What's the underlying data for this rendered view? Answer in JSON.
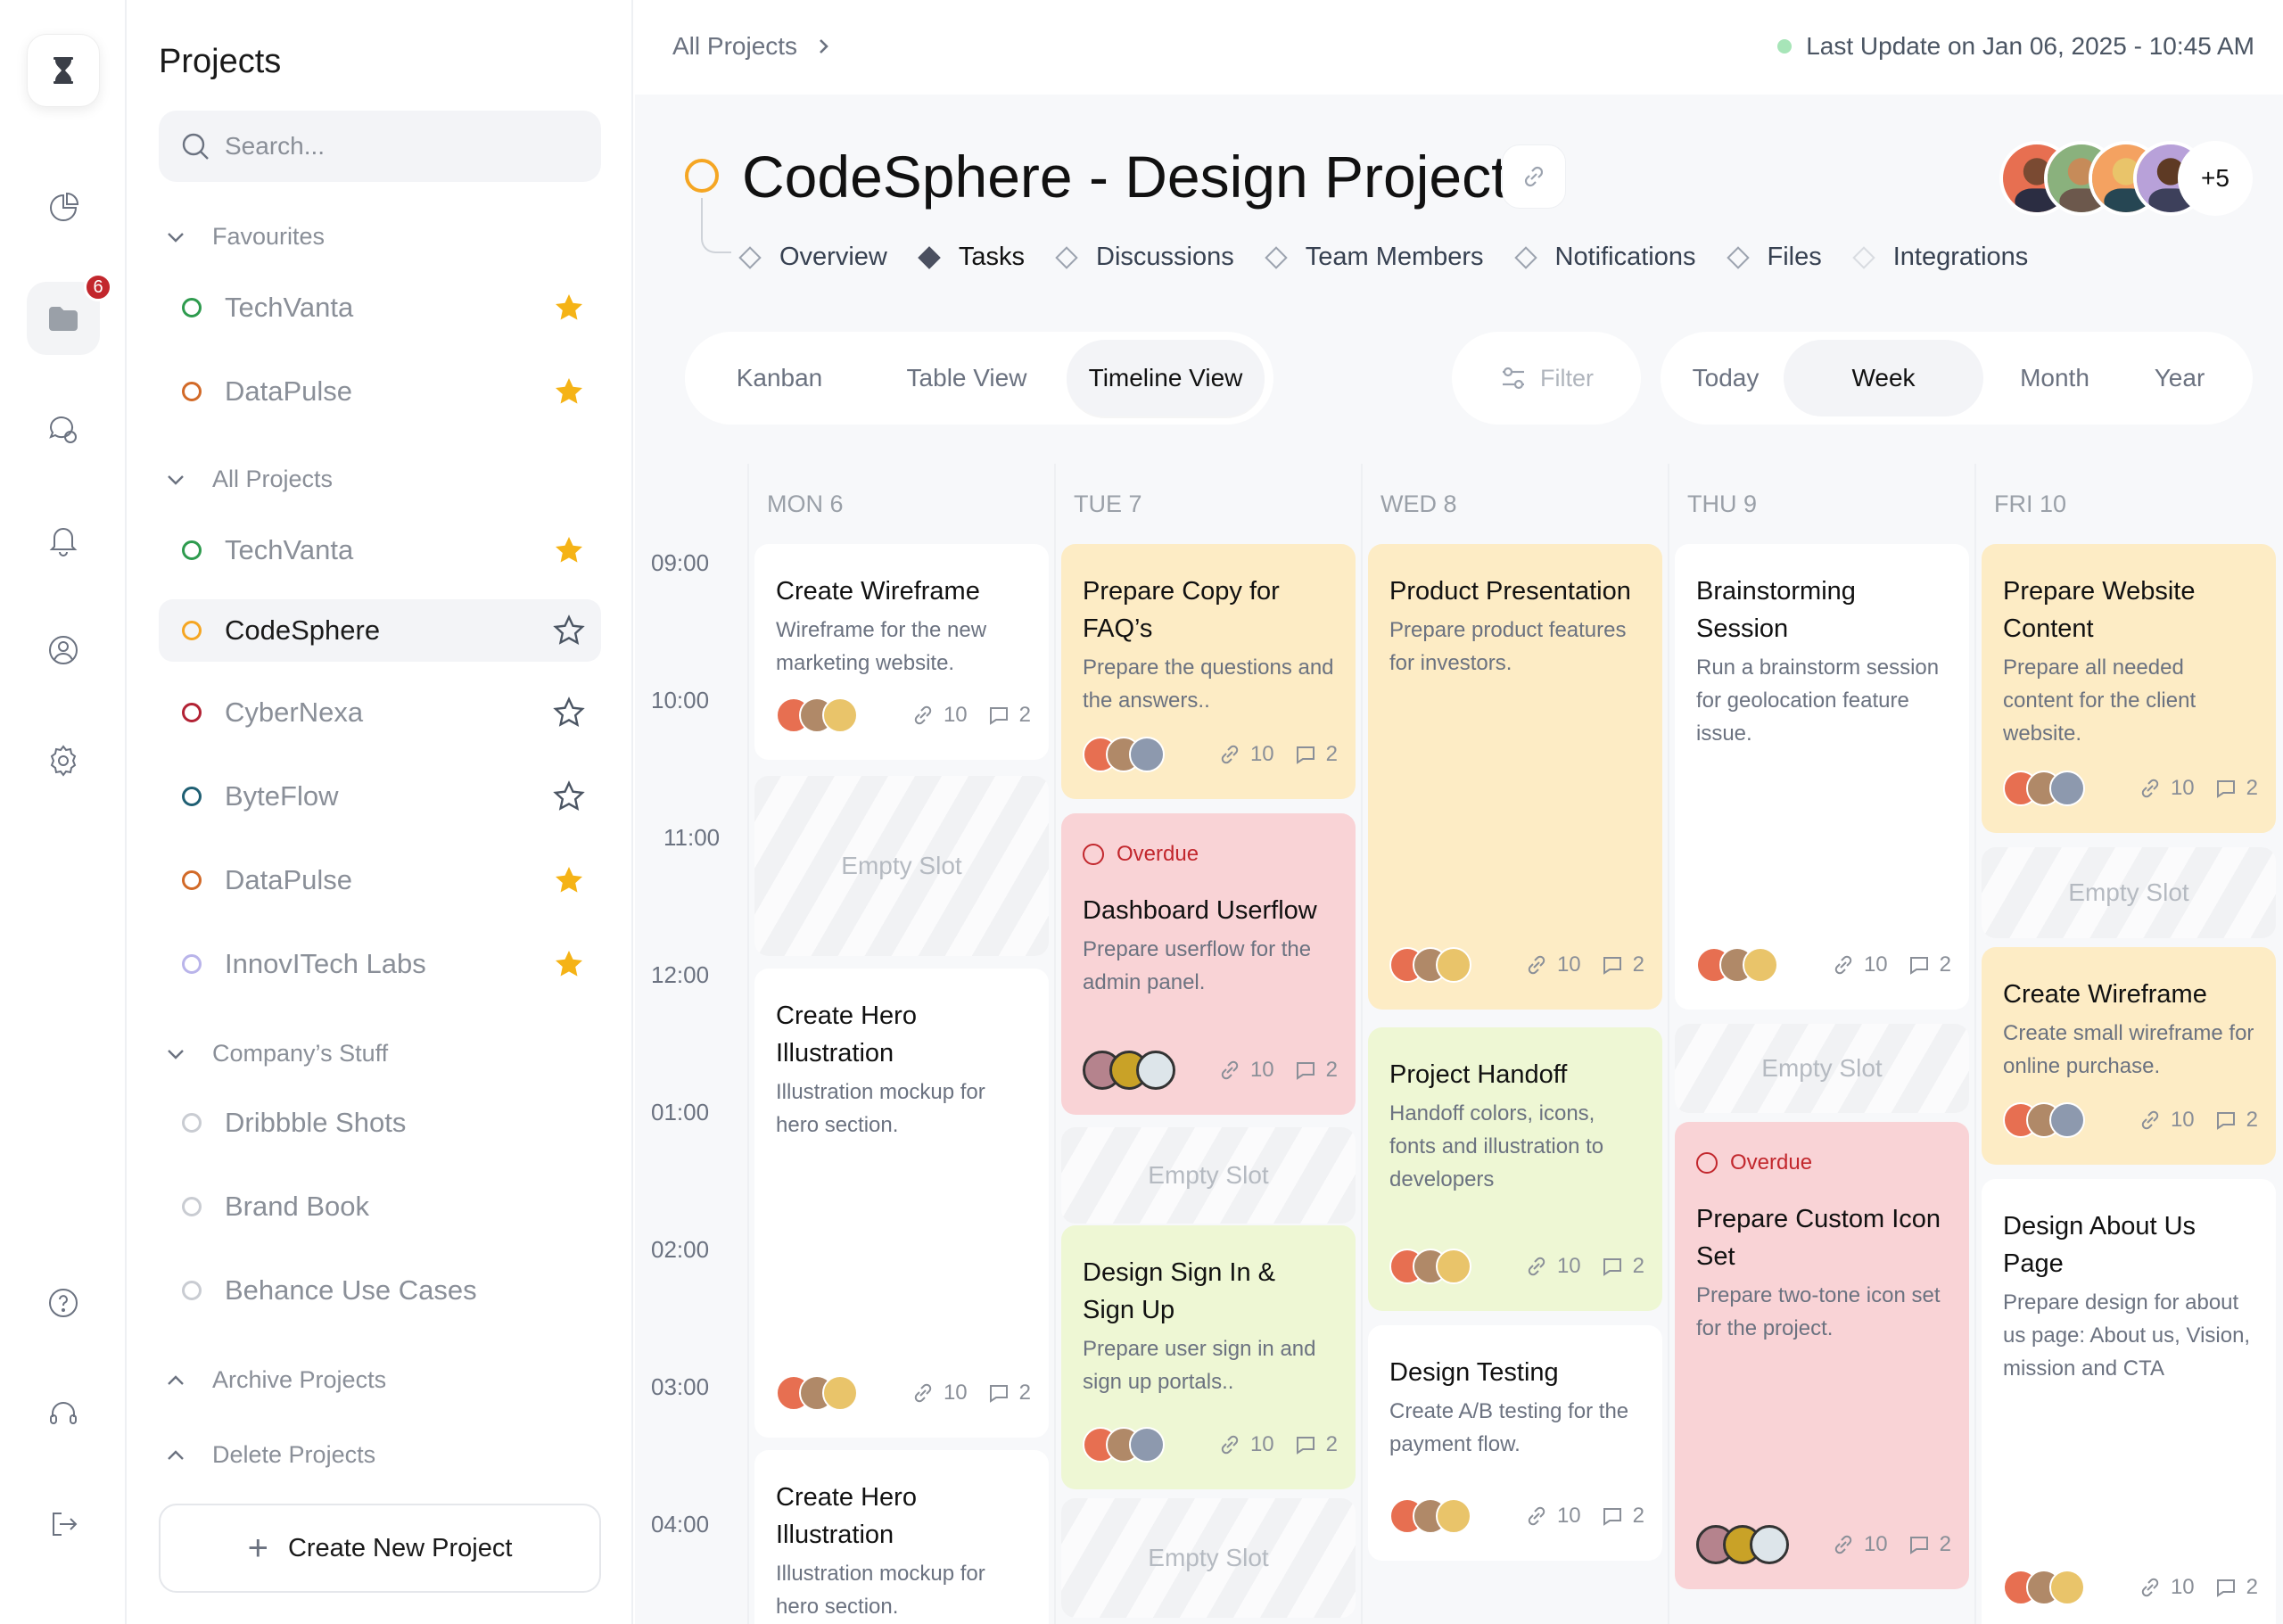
{
  "sidebar": {
    "title": "Projects",
    "search_placeholder": "Search...",
    "groups": {
      "favourites": "Favourites",
      "all_projects": "All Projects",
      "company": "Company’s Stuff",
      "archive": "Archive Projects",
      "delete": "Delete Projects"
    },
    "favourites": [
      {
        "name": "TechVanta",
        "color": "#2e9b4e",
        "starred": true
      },
      {
        "name": "DataPulse",
        "color": "#d26a28",
        "starred": true
      }
    ],
    "all_projects": [
      {
        "name": "TechVanta",
        "color": "#2e9b4e",
        "starred": true
      },
      {
        "name": "CodeSphere",
        "color": "#f5a623",
        "starred": false,
        "selected": true
      },
      {
        "name": "CyberNexa",
        "color": "#b22234",
        "starred": false
      },
      {
        "name": "ByteFlow",
        "color": "#1f5f73",
        "starred": false
      },
      {
        "name": "DataPulse",
        "color": "#d26a28",
        "starred": true
      },
      {
        "name": "InnovITech Labs",
        "color": "#b9b4ea",
        "starred": true
      }
    ],
    "company": [
      {
        "name": "Dribbble Shots",
        "color": "#c9ccd2"
      },
      {
        "name": "Brand Book",
        "color": "#c9ccd2"
      },
      {
        "name": "Behance Use Cases",
        "color": "#c9ccd2"
      }
    ],
    "create_label": "Create New Project"
  },
  "rail": {
    "badge": "6"
  },
  "topbar": {
    "breadcrumb": "All Projects",
    "last_update": "Last Update on Jan 06, 2025 - 10:45 AM"
  },
  "project": {
    "title": "CodeSphere - Design Project",
    "more_members": "+5",
    "tabs": [
      "Overview",
      "Tasks",
      "Discussions",
      "Team Members",
      "Notifications",
      "Files",
      "Integrations"
    ]
  },
  "views": [
    "Kanban",
    "Table View",
    "Timeline View"
  ],
  "filter_label": "Filter",
  "ranges": [
    "Today",
    "Week",
    "Month",
    "Year"
  ],
  "times": [
    "09:00",
    "10:00",
    "11:00",
    "12:00",
    "01:00",
    "02:00",
    "03:00",
    "04:00"
  ],
  "days": [
    "MON 6",
    "TUE 7",
    "WED 8",
    "THU 9",
    "FRI 10"
  ],
  "empty_label": "Empty Slot",
  "overdue_label": "Overdue",
  "meta": {
    "links": "10",
    "comments": "2"
  },
  "cards": {
    "mon_1": {
      "title": "Create Wireframe",
      "desc": "Wireframe for the new marketing website."
    },
    "mon_2": {
      "title": "Create Hero Illustration",
      "desc": "Illustration mockup for hero section."
    },
    "mon_3": {
      "title": "Create Hero Illustration",
      "desc": "Illustration mockup for hero section."
    },
    "tue_1": {
      "title": "Prepare Copy for FAQ’s",
      "desc": "Prepare the questions and the answers.."
    },
    "tue_2": {
      "title": "Dashboard Userflow",
      "desc": "Prepare userflow for the admin panel."
    },
    "tue_3": {
      "title": "Design Sign In & Sign Up",
      "desc": "Prepare user sign in and sign up portals.."
    },
    "wed_1": {
      "title": "Product Presentation",
      "desc": "Prepare product features for investors."
    },
    "wed_2": {
      "title": "Project Handoff",
      "desc": "Handoff colors, icons, fonts and illustration to developers"
    },
    "wed_3": {
      "title": "Design Testing",
      "desc": "Create A/B testing for the payment flow."
    },
    "thu_1": {
      "title": "Brainstorming Session",
      "desc": "Run a brainstorm session for geolocation feature issue."
    },
    "thu_2": {
      "title": "Prepare Custom Icon Set",
      "desc": "Prepare two-tone icon set for the project."
    },
    "fri_1": {
      "title": "Prepare Website Content",
      "desc": "Prepare all needed content for the client website."
    },
    "fri_2": {
      "title": "Create Wireframe",
      "desc": "Create small wireframe for online purchase."
    },
    "fri_3": {
      "title": "Design About Us Page",
      "desc": "Prepare design for about us page: About us, Vision, mission and CTA"
    }
  },
  "colors": {
    "accent": "#f5a623",
    "overdue": "#c2272d",
    "star": "#f5b316"
  }
}
